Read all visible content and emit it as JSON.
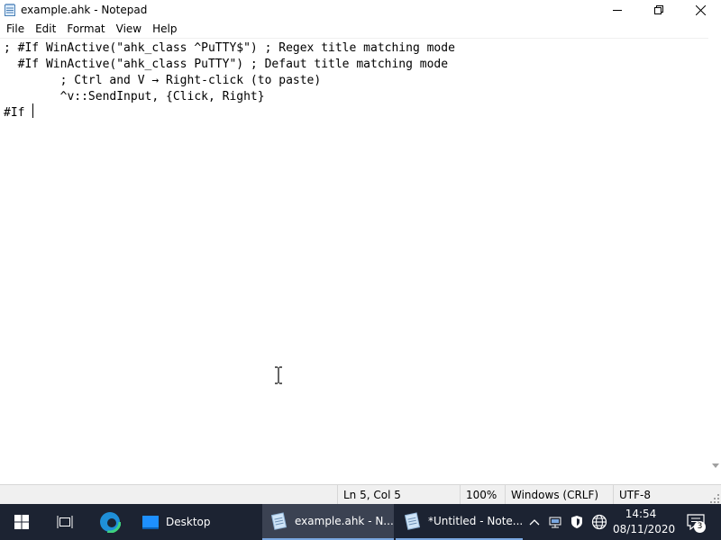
{
  "window": {
    "title": "example.ahk - Notepad",
    "icon": "notepad-icon",
    "controls": [
      "minimize-icon",
      "maximize-icon",
      "close-icon"
    ]
  },
  "menu": [
    "File",
    "Edit",
    "Format",
    "View",
    "Help"
  ],
  "editor": {
    "lines": [
      "; #If WinActive(\"ahk_class ^PuTTY$\") ; Regex title matching mode",
      "  #If WinActive(\"ahk_class PuTTY\") ; Defaut title matching mode",
      "        ; Ctrl and V → Right-click (to paste)",
      "        ^v::SendInput, {Click, Right}",
      "#If "
    ]
  },
  "status": {
    "position": "Ln 5, Col 5",
    "zoom": "100%",
    "line_endings": "Windows (CRLF)",
    "encoding": "UTF-8"
  },
  "taskbar": {
    "apps": [
      {
        "label": "Desktop",
        "icon": "desktop-icon"
      },
      {
        "label": "example.ahk - N...",
        "icon": "notepad-icon",
        "active": true
      },
      {
        "label": "*Untitled - Note...",
        "icon": "notepad-icon"
      }
    ],
    "tray_icons": [
      "chevron-up-icon",
      "network-icon",
      "defender-icon",
      "globe-icon"
    ],
    "clock": {
      "time": "14:54",
      "date": "08/11/2020"
    },
    "notification_count": "3"
  },
  "colors": {
    "taskbar": "#1c2332",
    "taskbar_active": "#3b4252",
    "accent": "#7aa7e0",
    "statusbar": "#f0f0f0"
  }
}
